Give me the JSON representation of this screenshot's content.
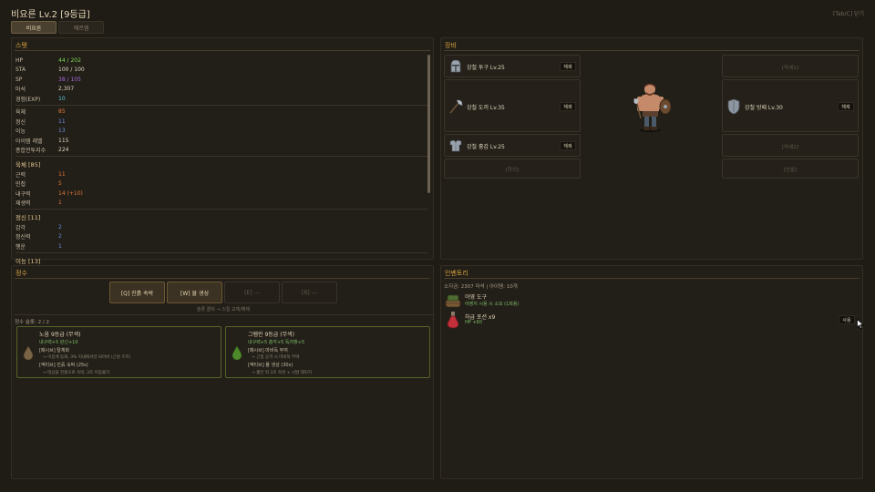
{
  "header": {
    "title": "비요른 Lv.2 [9등급]",
    "hint": "[Tab/C] 닫기"
  },
  "tabs": [
    {
      "label": "비요른",
      "active": true
    },
    {
      "label": "에르웬",
      "active": false
    }
  ],
  "stats": {
    "title": "스탯",
    "basic": [
      {
        "label": "HP",
        "value": "44 / 202",
        "color": "#7ed957"
      },
      {
        "label": "STA",
        "value": "100 / 100",
        "color": "#e0d6bf"
      },
      {
        "label": "SP",
        "value": "38 / 105",
        "color": "#a66bdc"
      },
      {
        "label": "마석",
        "value": "2,307",
        "color": "#e0d6bf"
      },
      {
        "label": "경험(EXP)",
        "value": "10",
        "color": "#5ec7d8"
      }
    ],
    "attributes": [
      {
        "label": "육체",
        "value": "85",
        "color": "#e07a3a"
      },
      {
        "label": "정신",
        "value": "11",
        "color": "#6a8fe0"
      },
      {
        "label": "이능",
        "value": "13",
        "color": "#6a8fe0"
      },
      {
        "label": "아이템 레벨",
        "value": "115",
        "color": "#e0d6bf"
      },
      {
        "label": "종합전투지수",
        "value": "224",
        "color": "#e0d6bf"
      }
    ],
    "groups": [
      {
        "title": "육체 [85]",
        "rows": [
          {
            "label": "근력",
            "value": "11",
            "color": "#e07a3a"
          },
          {
            "label": "민첩",
            "value": "5",
            "color": "#e07a3a"
          },
          {
            "label": "내구력",
            "value": "14 (+10)",
            "color": "#e07a3a"
          },
          {
            "label": "재생력",
            "value": "1",
            "color": "#e07a3a"
          }
        ]
      },
      {
        "title": "정신 [11]",
        "rows": [
          {
            "label": "감각",
            "value": "2",
            "color": "#6a8fe0"
          },
          {
            "label": "정신력",
            "value": "2",
            "color": "#6a8fe0"
          },
          {
            "label": "행운",
            "value": "1",
            "color": "#6a8fe0"
          }
        ]
      },
      {
        "title": "이능 [13]",
        "rows": []
      }
    ]
  },
  "equipment": {
    "title": "장비",
    "helmet": {
      "name": "강철 투구 Lv.25",
      "button": "해제"
    },
    "weapon": {
      "name": "강철 도끼 Lv.35",
      "button": "해제"
    },
    "armor": {
      "name": "강철 흉갑 Lv.25",
      "button": "해제"
    },
    "shield": {
      "name": "강철 방패 Lv.30",
      "button": "해제"
    },
    "feet": "[하의]",
    "accessory1": "[악세1]",
    "accessory2": "[악세2]",
    "boots": "[신발]"
  },
  "essence": {
    "title": "정수",
    "skills": [
      {
        "label": "[Q] 진흙 속박",
        "active": true
      },
      {
        "label": "[W] 뮬 생성",
        "active": true
      },
      {
        "label": "[E] ---",
        "active": false
      },
      {
        "label": "[R] ---",
        "active": false
      }
    ],
    "hint": "슬롯 클릭 → 스킬 교체/해제",
    "slots": "정수 슬롯: 2 / 2",
    "cards": [
      {
        "title": "노움 9등급 (무색)",
        "stats": "내구력+5 완신+10",
        "passive": "[패시브] 탈체화",
        "passive_desc": "→ 이동에 동화, 3% 이내에서만 되어버 (근성 흐르)",
        "active": "[액티브] 진흙 속박 (25s)",
        "active_desc": "→ 대상을 진흙으로 속박, 3초 이동불가"
      },
      {
        "title": "그렘린 9등급 (무색)",
        "stats": "내구력+5 흡각+5 독저항+5",
        "passive": "[패시브] 마비독 부여",
        "passive_desc": "→ 근접 공격 시 마비독 부여",
        "active": "[액티브] 뮬 생성 (30s)",
        "active_desc": "→ 짧은 뒤 3초 속박 + 시발 데미지"
      }
    ]
  },
  "inventory": {
    "title": "인벤토리",
    "summary": "소지금: 2307 마석  |  아이템: 10개",
    "items": [
      {
        "name": "야영 도구",
        "desc": "야영지 시용 시 소모 (1회용)"
      },
      {
        "name": "하급 포션 x9",
        "desc": "HP +60",
        "button": "사용"
      }
    ]
  }
}
